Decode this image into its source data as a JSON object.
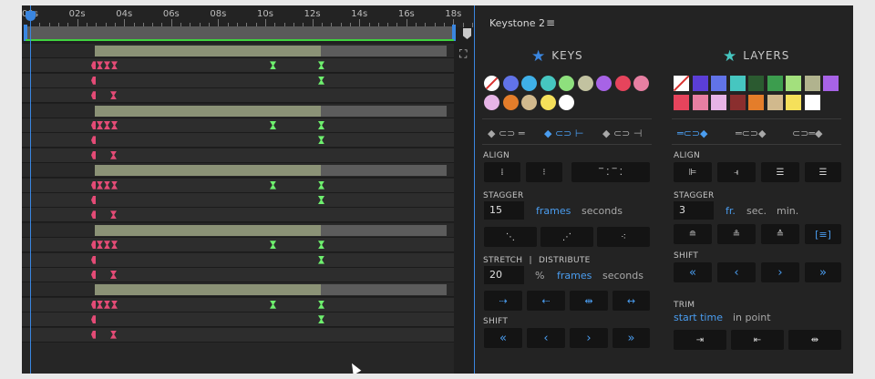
{
  "timeline": {
    "ruler_labels": [
      "00s",
      "02s",
      "04s",
      "06s",
      "08s",
      "10s",
      "12s",
      "14s",
      "16s",
      "18s"
    ]
  },
  "panel": {
    "title": "Keystone 2",
    "menu_icon": "hamburger-icon",
    "keys": {
      "heading": "KEYS",
      "icon": "star-icon",
      "colors": [
        "#ffffff",
        "#6173e8",
        "#3fb0e8",
        "#46c6c0",
        "#8ee07d",
        "#c2c2a0",
        "#a763e6",
        "#e6445c",
        "#e77fa2",
        "#e6b4e6",
        "#e47d2a",
        "#d1b98d",
        "#f5e05a",
        "#ffffff"
      ],
      "link_modes": [
        "◆ ⊂⊃ ═",
        "◆ ⊂⊃ ⊢",
        "◆ ⊂⊃ ⊣"
      ],
      "align_label": "ALIGN",
      "stagger_label": "STAGGER",
      "stagger_value": "15",
      "stagger_units": [
        "frames",
        "seconds"
      ],
      "stretch_label": "STRETCH",
      "distribute_label": "DISTRIBUTE",
      "stretch_sep": "|",
      "stretch_value": "20",
      "stretch_units": [
        "%",
        "frames",
        "seconds"
      ],
      "shift_label": "SHIFT",
      "shift_buttons": [
        "«",
        "‹",
        "›",
        "»"
      ]
    },
    "layers": {
      "heading": "LAYERS",
      "icon": "star-icon",
      "colors": [
        "#ffffff",
        "#5b3ed6",
        "#6173e8",
        "#46c6c0",
        "#2b5a30",
        "#3c9d4e",
        "#a3e07d",
        "#b1b38e",
        "#a763e6",
        "#e6445c",
        "#e77fa2",
        "#e6b4e6",
        "#8a2e2e",
        "#e47d2a",
        "#d1b98d",
        "#f5e05a",
        "#ffffff"
      ],
      "link_modes": [
        "═⊂⊃◆",
        "═⊂⊃◆",
        "⊂⊃═◆"
      ],
      "align_label": "ALIGN",
      "stagger_label": "STAGGER",
      "stagger_value": "3",
      "stagger_units": [
        "fr.",
        "sec.",
        "min."
      ],
      "shift_label": "SHIFT",
      "shift_buttons": [
        "«",
        "‹",
        "›",
        "»"
      ],
      "trim_label": "TRIM",
      "trim_options": [
        "start time",
        "in point"
      ]
    }
  }
}
